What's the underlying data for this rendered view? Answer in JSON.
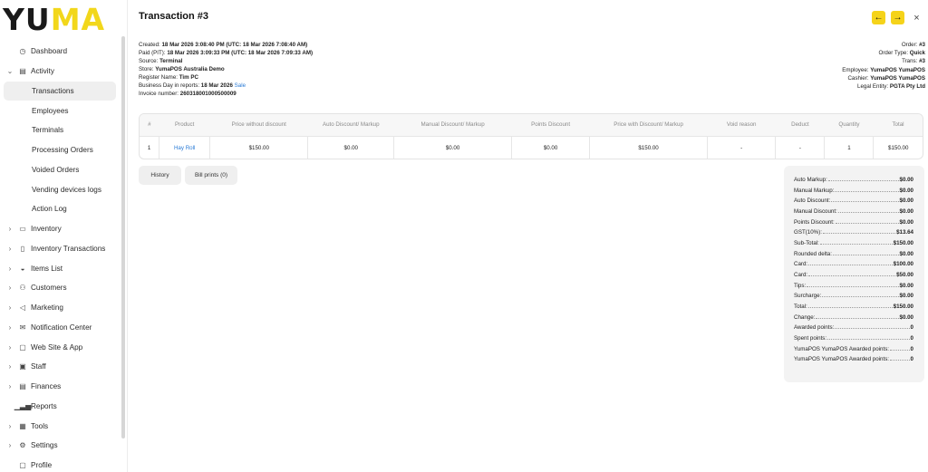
{
  "brand": {
    "logo_a": "YU",
    "logo_b": "MA"
  },
  "sidebar": {
    "items": [
      {
        "label": "Dashboard",
        "icon": "dashboard-icon",
        "glyph": "◷",
        "chevron": ""
      },
      {
        "label": "Activity",
        "icon": "activity-icon",
        "glyph": "▤",
        "chevron": "⌄"
      },
      {
        "label": "Transactions",
        "sub": true,
        "active": true
      },
      {
        "label": "Employees",
        "sub": true
      },
      {
        "label": "Terminals",
        "sub": true
      },
      {
        "label": "Processing Orders",
        "sub": true
      },
      {
        "label": "Voided Orders",
        "sub": true
      },
      {
        "label": "Vending devices logs",
        "sub": true
      },
      {
        "label": "Action Log",
        "sub": true
      },
      {
        "label": "Inventory",
        "icon": "inventory-icon",
        "glyph": "▭",
        "chevron": "›"
      },
      {
        "label": "Inventory Transactions",
        "icon": "inventory-transactions-icon",
        "glyph": "▯",
        "chevron": "›"
      },
      {
        "label": "Items List",
        "icon": "items-list-icon",
        "glyph": "◒",
        "chevron": "›"
      },
      {
        "label": "Customers",
        "icon": "customers-icon",
        "glyph": "⚇",
        "chevron": "›"
      },
      {
        "label": "Marketing",
        "icon": "marketing-icon",
        "glyph": "◁",
        "chevron": "›"
      },
      {
        "label": "Notification Center",
        "icon": "envelope-icon",
        "glyph": "✉",
        "chevron": "›"
      },
      {
        "label": "Web Site & App",
        "icon": "devices-icon",
        "glyph": "▢",
        "chevron": "›"
      },
      {
        "label": "Staff",
        "icon": "staff-icon",
        "glyph": "▣",
        "chevron": "›"
      },
      {
        "label": "Finances",
        "icon": "finances-icon",
        "glyph": "▤",
        "chevron": "›"
      },
      {
        "label": "Reports",
        "icon": "reports-icon",
        "glyph": "▁▃▅",
        "chevron": ""
      },
      {
        "label": "Tools",
        "icon": "tools-icon",
        "glyph": "▦",
        "chevron": "›"
      },
      {
        "label": "Settings",
        "icon": "gear-icon",
        "glyph": "⚙",
        "chevron": "›"
      },
      {
        "label": "Profile",
        "icon": "profile-icon",
        "glyph": "▢",
        "chevron": ""
      }
    ]
  },
  "header": {
    "title": "Transaction #3",
    "prev_glyph": "←",
    "next_glyph": "→",
    "close_glyph": "×"
  },
  "info_left": [
    {
      "k": "Created:",
      "v": "18 Mar 2026 3:08:40 PM (UTC: 18 Mar 2026 7:08:40 AM)"
    },
    {
      "k": "Paid (PIT):",
      "v": "18 Mar 2026 3:09:33 PM (UTC: 18 Mar 2026 7:09:33 AM)"
    },
    {
      "k": "Source:",
      "v": "Terminal"
    },
    {
      "k": "Store:",
      "v": "YumaPOS Australia Demo"
    },
    {
      "k": "Register Name:",
      "v": "Tim PC"
    },
    {
      "k": "Business Day in reports:",
      "v": "18 Mar 2026",
      "link": "Sale"
    },
    {
      "k": "Invoice number:",
      "v": "260318001000500009"
    }
  ],
  "info_right": [
    {
      "k": "Order:",
      "v": "#3"
    },
    {
      "k": "Order Type:",
      "v": "Quick"
    },
    {
      "k": "Trans:",
      "v": "#3"
    },
    {
      "k": "Employee:",
      "v": "YumaPOS YumaPOS"
    },
    {
      "k": "Cashier:",
      "v": "YumaPOS YumaPOS"
    },
    {
      "k": "Legal Entity:",
      "v": "PGTA Pty Ltd"
    }
  ],
  "table": {
    "columns": [
      "#",
      "Product",
      "Price without discount",
      "Auto Discount/ Markup",
      "Manual Discount/ Markup",
      "Points Discount",
      "Price with Discount/ Markup",
      "Void reason",
      "Deduct",
      "Quantity",
      "Total"
    ],
    "rows": [
      [
        "1",
        "Hay Roll",
        "$150.00",
        "$0.00",
        "$0.00",
        "$0.00",
        "$150.00",
        "-",
        "-",
        "1",
        "$150.00"
      ]
    ]
  },
  "actions": {
    "history": "History",
    "bill_prints": "Bill prints (0)"
  },
  "totals": [
    {
      "k": "Auto Markup:",
      "v": "$0.00"
    },
    {
      "k": "Manual Markup:",
      "v": "$0.00"
    },
    {
      "k": "Auto Discount:",
      "v": "$0.00"
    },
    {
      "k": "Manual Discount:",
      "v": "$0.00"
    },
    {
      "k": "Points Discount:",
      "v": "$0.00"
    },
    {
      "k": "GST(10%):",
      "v": "$13.64"
    },
    {
      "k": "Sub-Total:",
      "v": "$150.00"
    },
    {
      "k": "Rounded delta:",
      "v": "$0.00"
    },
    {
      "k": "Card:",
      "v": "$100.00"
    },
    {
      "k": "Card:",
      "v": "$50.00"
    },
    {
      "k": "Tips:",
      "v": "$0.00"
    },
    {
      "k": "Surcharge:",
      "v": "$0.00"
    },
    {
      "k": "Total:",
      "v": "$150.00"
    },
    {
      "k": "Change:",
      "v": "$0.00"
    },
    {
      "k": "Awarded points:",
      "v": "0"
    },
    {
      "k": "Spent points:",
      "v": "0"
    },
    {
      "k": "YumaPOS YumaPOS Awarded points:",
      "v": "0"
    },
    {
      "k": "YumaPOS YumaPOS Awarded points:",
      "v": "0"
    }
  ],
  "colors": {
    "accent": "#f5d31a",
    "link": "#2a7bd6"
  }
}
